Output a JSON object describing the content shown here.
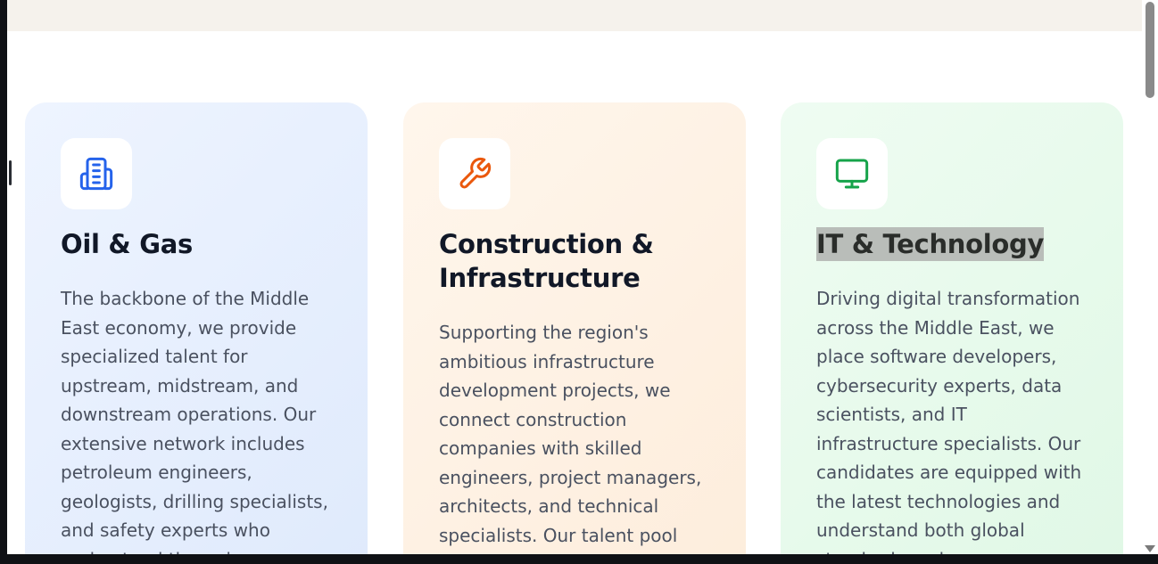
{
  "cards": [
    {
      "icon": "building-icon",
      "title": "Oil & Gas",
      "body": "The backbone of the Middle East economy, we provide specialized talent for upstream, midstream, and downstream operations. Our extensive network includes petroleum engineers, geologists, drilling specialists, and safety experts who understand the unique"
    },
    {
      "icon": "wrench-icon",
      "title": "Construction & Infrastructure",
      "body": "Supporting the region's ambitious infrastructure development projects, we connect construction companies with skilled engineers, project managers, architects, and technical specialists. Our talent pool"
    },
    {
      "icon": "monitor-icon",
      "title": "IT & Technology",
      "body": "Driving digital transformation across the Middle East, we place software developers, cybersecurity experts, data scientists, and IT infrastructure specialists. Our candidates are equipped with the latest technologies and understand both global standards and"
    }
  ],
  "colors": {
    "blue_icon": "#2563eb",
    "orange_icon": "#ea580c",
    "green_icon": "#16a34a"
  }
}
